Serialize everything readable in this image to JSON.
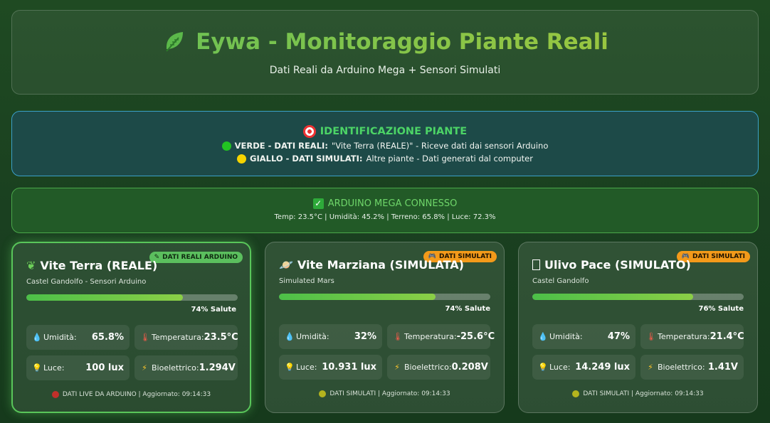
{
  "header": {
    "title": "Eywa - Monitoraggio Piante Reali",
    "subtitle": "Dati Reali da Arduino Mega + Sensori Simulati",
    "icon": "leaf-icon"
  },
  "identification": {
    "title": "IDENTIFICAZIONE PIANTE",
    "green_label": "VERDE - DATI REALI:",
    "green_text": "\"Vite Terra (REALE)\" - Riceve dati dai sensori Arduino",
    "yellow_label": "GIALLO - DATI SIMULATI:",
    "yellow_text": "Altre piante - Dati generati dal computer"
  },
  "arduino": {
    "title": "ARDUINO MEGA CONNESSO",
    "readings": "Temp: 23.5°C | Umidità: 45.2% | Terreno: 65.8% | Luce: 72.3%"
  },
  "cards": [
    {
      "name": "Vite Terra (REALE)",
      "location": "Castel Gandolfo - Sensori Arduino",
      "badge": "DATI REALI ARDUINO",
      "health_value": 0.74,
      "health_label": "74% Salute",
      "humidity_label": "Umidità:",
      "humidity": "65.8%",
      "temp_label": "Temperatura:",
      "temp": "23.5°C",
      "light_label": "Luce:",
      "light": "100 lux",
      "bio_label": "Bioelettrico:",
      "bio": "1.294V",
      "footer": "DATI LIVE DA ARDUINO | Aggiornato: 09:14:33"
    },
    {
      "name": "Vite Marziana (SIMULATA)",
      "location": "Simulated Mars",
      "badge": "DATI SIMULATI",
      "health_value": 0.74,
      "health_label": "74% Salute",
      "humidity_label": "Umidità:",
      "humidity": "32%",
      "temp_label": "Temperatura:",
      "temp": "-25.6°C",
      "light_label": "Luce:",
      "light": "10.931 lux",
      "bio_label": "Bioelettrico:",
      "bio": "0.208V",
      "footer": "DATI SIMULATI | Aggiornato: 09:14:33"
    },
    {
      "name": "Ulivo Pace (SIMULATO)",
      "location": "Castel Gandolfo",
      "badge": "DATI SIMULATI",
      "health_value": 0.76,
      "health_label": "76% Salute",
      "humidity_label": "Umidità:",
      "humidity": "47%",
      "temp_label": "Temperatura:",
      "temp": "21.4°C",
      "light_label": "Luce:",
      "light": "14.249 lux",
      "bio_label": "Bioelettrico:",
      "bio": "1.41V",
      "footer": "DATI SIMULATI | Aggiornato: 09:14:33"
    }
  ],
  "colors": {
    "accent_green": "#4cd466",
    "real_border": "#59c65a",
    "sim_badge": "#f39a1a"
  }
}
